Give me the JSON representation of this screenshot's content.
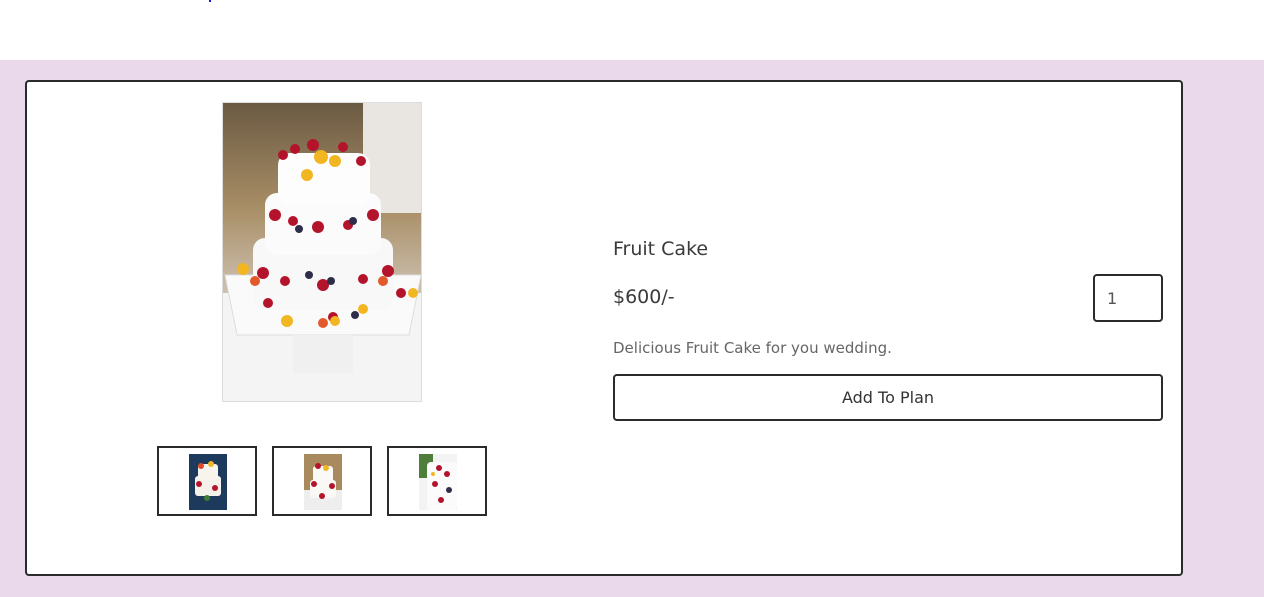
{
  "product": {
    "name": "Fruit Cake",
    "price": "$600/-",
    "description": "Delicious Fruit Cake for you wedding.",
    "quantity": "1",
    "add_button_label": "Add To Plan"
  },
  "gallery": {
    "thumbnails": [
      "cake-photo-1",
      "cake-photo-2",
      "cake-photo-3"
    ]
  },
  "colors": {
    "section_background": "#ead9ea",
    "border": "#2b2b2b"
  }
}
